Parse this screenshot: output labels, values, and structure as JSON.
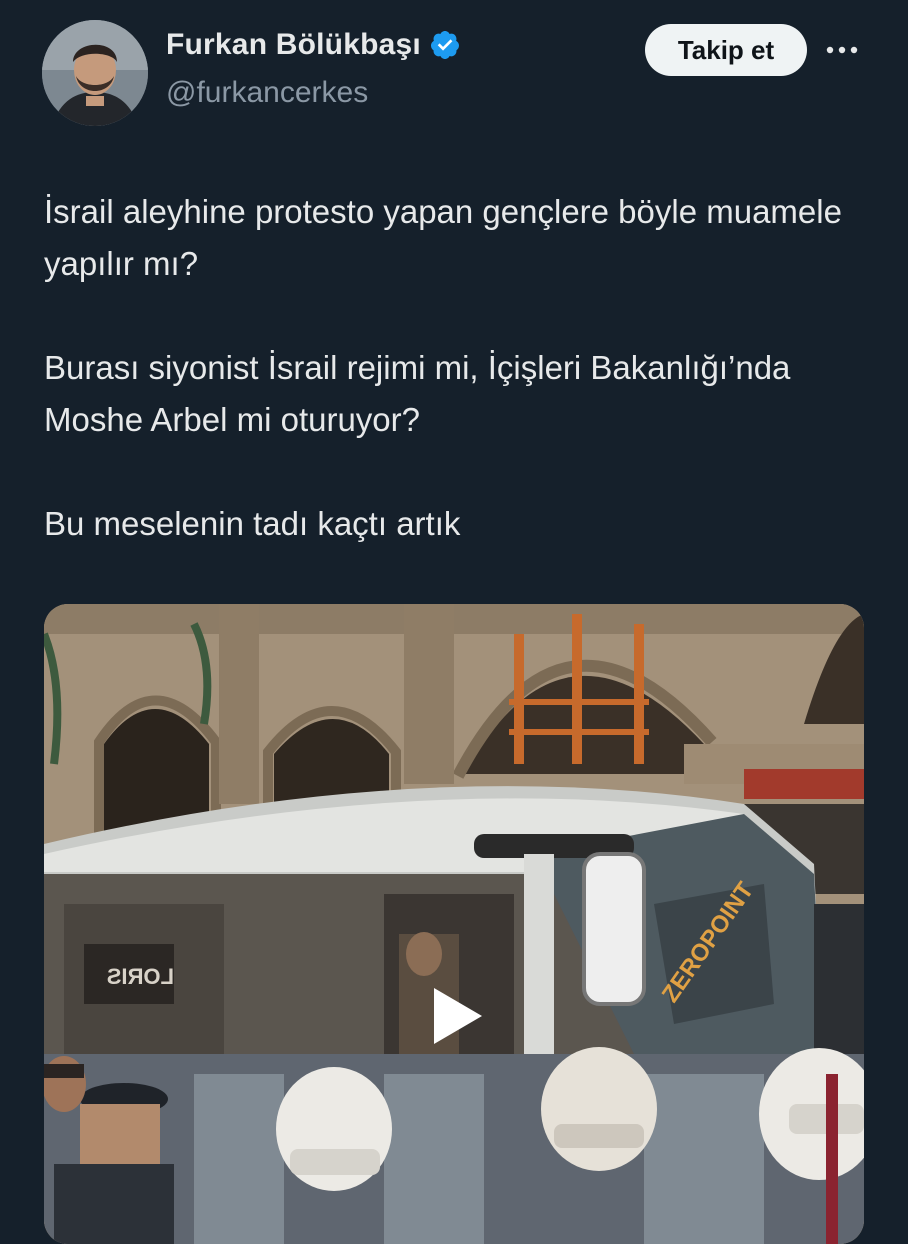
{
  "author": {
    "display_name": "Furkan Bölükbaşı",
    "handle": "@furkancerkes",
    "verified_icon": "verified-badge-icon"
  },
  "actions": {
    "follow_label": "Takip et",
    "more_icon": "more-options-icon"
  },
  "tweet": {
    "paragraphs": [
      "İsrail aleyhine protesto yapan gençlere böyle muamele yapılır mı?",
      "Burası siyonist İsrail rejimi mi, İçişleri Bakanlığı’nda Moshe Arbel mi oturuyor?",
      "Bu meselenin tadı kaçtı artık"
    ]
  },
  "media": {
    "type": "video",
    "play_icon": "play-icon",
    "sign_text": "LORIS",
    "bus_text": "ZEROPOINT"
  },
  "colors": {
    "background": "#15202b",
    "text_primary": "#e7e9ea",
    "text_secondary": "#8b98a5",
    "verified": "#1d9bf0",
    "follow_bg": "#eff3f4"
  }
}
